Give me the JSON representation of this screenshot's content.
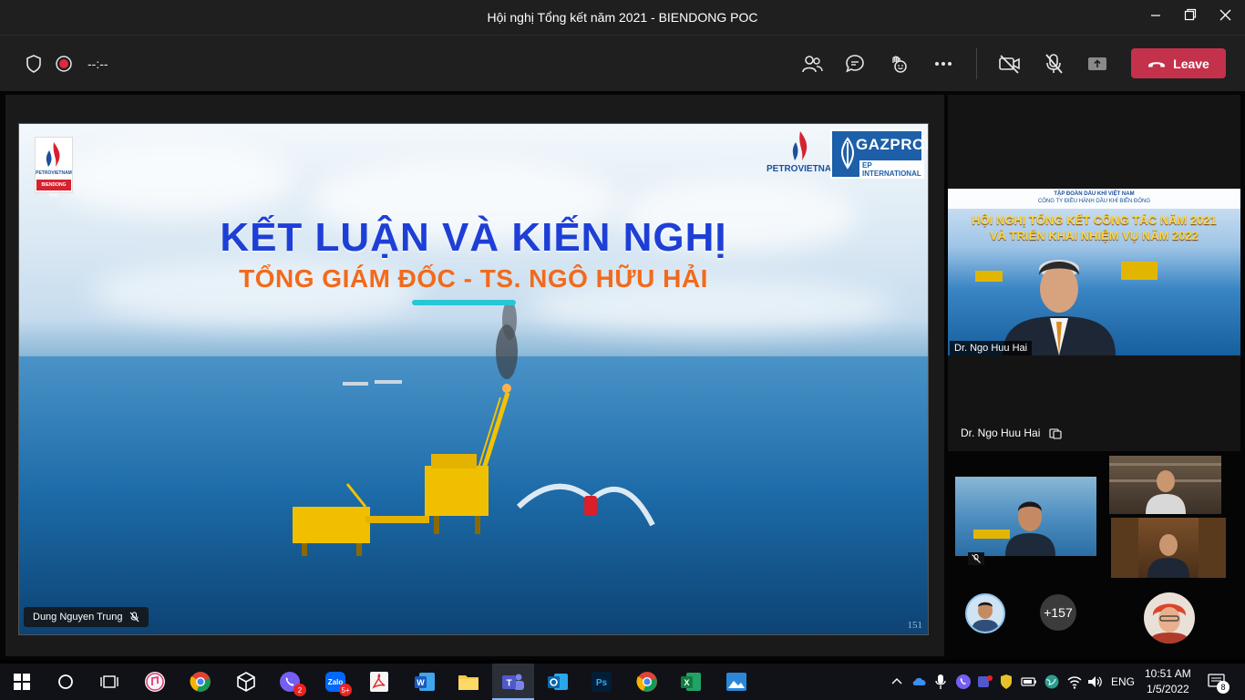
{
  "window": {
    "title": "Hội nghị Tổng kết năm 2021 - BIENDONG POC"
  },
  "toolbar": {
    "timer": "--:--",
    "leave_label": "Leave",
    "icons": [
      "shield-icon",
      "record-icon",
      "people-icon",
      "chat-icon",
      "reactions-icon",
      "more-icon",
      "camera-off-icon",
      "mic-off-icon",
      "share-icon"
    ]
  },
  "slide": {
    "title": "KẾT LUẬN VÀ KIẾN NGHỊ",
    "subtitle": "TỔNG GIÁM ĐỐC - TS. NGÔ HỮU HẢI",
    "logo_left_text": "PETROVIETNAM",
    "logo_left_sub": "BIENDONG POC",
    "logo_right_brand": "GAZPROM",
    "logo_right_sub": "EP INTERNATIONAL",
    "petrovietnam_text": "PETROVIETNAM",
    "page_number": "151",
    "presenter": "Dung Nguyen Trung"
  },
  "speaker": {
    "banner_line1": "TẬP ĐOÀN DẦU KHÍ VIỆT NAM",
    "banner_line2": "CÔNG TY ĐIỀU HÀNH DẦU KHÍ BIỂN ĐÔNG",
    "banner_title1": "HỘI NGHỊ TỔNG KẾT CÔNG TÁC NĂM 2021",
    "banner_title2": "VÀ TRIỂN KHAI NHIỆM VỤ NĂM 2022",
    "video_label": "Dr. Ngo Huu Hai",
    "name": "Dr. Ngo Huu Hai"
  },
  "participants": {
    "overflow_count": "+157"
  },
  "taskbar": {
    "language": "ENG",
    "time": "10:51 AM",
    "date": "1/5/2022",
    "notifications": "8",
    "viber_badge": "2",
    "zalo_badge": "5+"
  }
}
